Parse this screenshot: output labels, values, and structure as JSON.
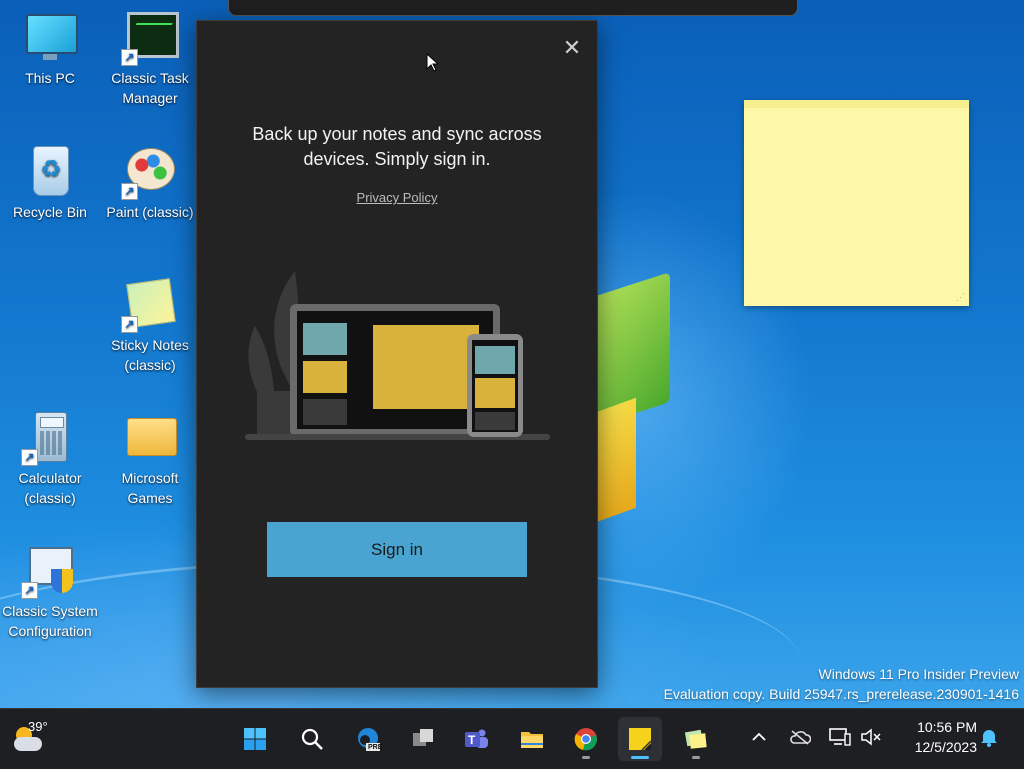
{
  "desktop": {
    "icons": [
      {
        "label": "This PC",
        "icon": "this-pc-icon"
      },
      {
        "label": "Classic Task Manager",
        "icon": "task-manager-icon"
      },
      {
        "label": "Recycle Bin",
        "icon": "recycle-bin-icon"
      },
      {
        "label": "Paint (classic)",
        "icon": "paint-icon"
      },
      {
        "label": "Sticky Notes (classic)",
        "icon": "sticky-notes-icon"
      },
      {
        "label": "Calculator (classic)",
        "icon": "calculator-icon"
      },
      {
        "label": "Microsoft Games",
        "icon": "folder-icon"
      },
      {
        "label": "Classic System Configuration",
        "icon": "system-config-icon"
      }
    ],
    "watermark": {
      "line1": "Windows 11 Pro Insider Preview",
      "line2": "Evaluation copy. Build 25947.rs_prerelease.230901-1416"
    }
  },
  "dialog": {
    "close_glyph": "✕",
    "title": "Back up your notes and sync across devices. Simply sign in.",
    "privacy_link": "Privacy Policy",
    "sign_in_label": "Sign in",
    "accent": "#4aa4d2"
  },
  "taskbar": {
    "weather": {
      "temp": "39°",
      "icon": "weather-cloudy-icon"
    },
    "apps": [
      {
        "name": "start-button",
        "icon": "windows-logo-icon"
      },
      {
        "name": "search-button",
        "icon": "search-icon"
      },
      {
        "name": "edge-preview-button",
        "icon": "edge-icon",
        "badge": "PRE"
      },
      {
        "name": "task-view-button",
        "icon": "task-view-icon"
      },
      {
        "name": "teams-button",
        "icon": "teams-icon",
        "badge": "T"
      },
      {
        "name": "file-explorer-button",
        "icon": "folder-icon"
      },
      {
        "name": "chrome-button",
        "icon": "chrome-icon"
      },
      {
        "name": "sticky-notes-button",
        "icon": "sticky-notes-icon"
      },
      {
        "name": "sticky-notes-classic-button",
        "icon": "sticky-notes-classic-icon"
      }
    ],
    "tray": {
      "chevron": "^",
      "clock_time": "10:56 PM",
      "clock_date": "12/5/2023"
    }
  }
}
